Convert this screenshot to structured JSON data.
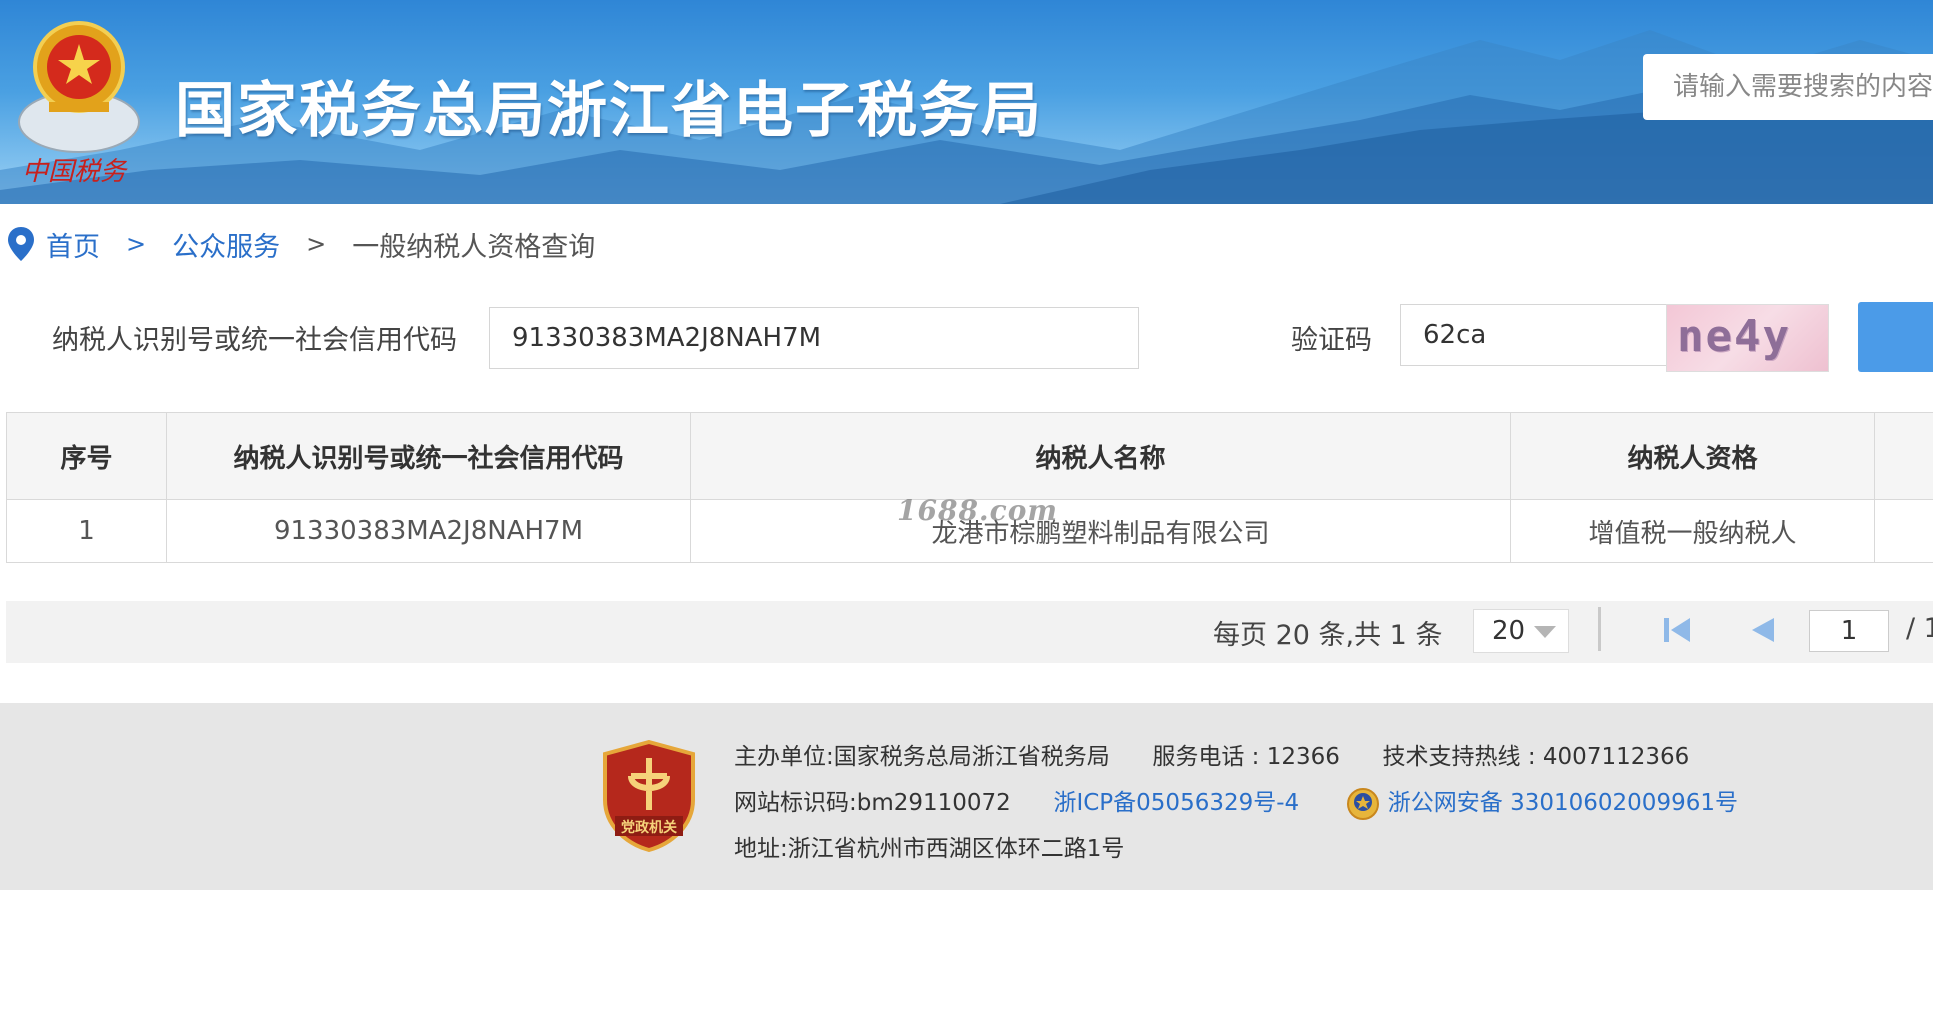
{
  "header": {
    "title": "国家税务总局浙江省电子税务局",
    "emblem_text": "中国税务",
    "search_placeholder": "请输入需要搜索的内容"
  },
  "breadcrumb": {
    "home": "首页",
    "sep1": ">",
    "section": "公众服务",
    "sep2": ">",
    "current": "一般纳税人资格查询"
  },
  "query": {
    "taxpayer_id_label": "纳税人识别号或统一社会信用代码",
    "taxpayer_id_value": "91330383MA2J8NAH7M",
    "captcha_label": "验证码",
    "captcha_input_value": "62ca",
    "captcha_image_text": "ne4y"
  },
  "table": {
    "headers": [
      "序号",
      "纳税人识别号或统一社会信用代码",
      "纳税人名称",
      "纳税人资格"
    ],
    "rows": [
      [
        "1",
        "91330383MA2J8NAH7M",
        "龙港市棕鹏塑料制品有限公司",
        "增值税一般纳税人"
      ]
    ],
    "watermark": "1688.com"
  },
  "pagination": {
    "summary": "每页 20 条,共 1 条",
    "page_size": "20",
    "current_page": "1",
    "total_pages": "/ 1"
  },
  "footer": {
    "host_label": "主办单位:",
    "host_value": "国家税务总局浙江省税务局",
    "phone": "服务电话 : 12366",
    "support": "技术支持热线 : 4007112366",
    "site_id": "网站标识码:bm29110072",
    "icp": "浙ICP备05056329号-4",
    "police": "浙公网安备 33010602009961号",
    "address": "地址:浙江省杭州市西湖区体环二路1号",
    "badge_text": "党政机关"
  },
  "colors": {
    "link": "#2a6fc9",
    "header_blue": "#2f86d6",
    "button_blue": "#4b9be8",
    "footer_bg": "#e6e6e6"
  },
  "icons": [
    "national-tax-emblem-icon",
    "location-pin-icon",
    "first-page-icon",
    "prev-page-icon",
    "party-govt-badge-icon",
    "police-badge-icon"
  ]
}
